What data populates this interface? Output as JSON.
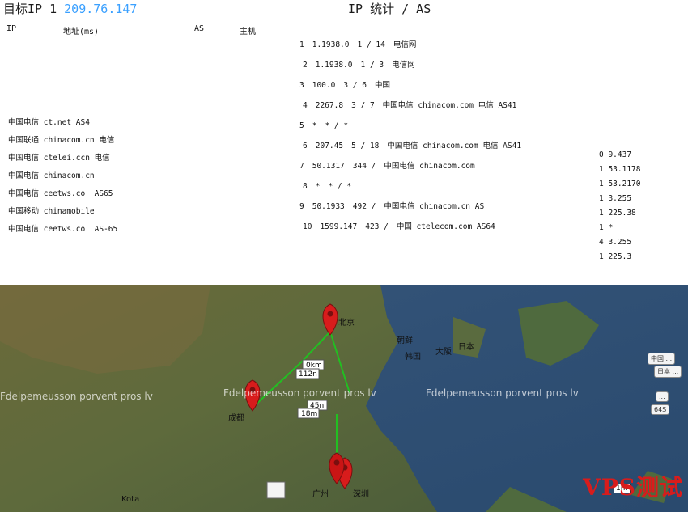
{
  "header": {
    "ip_prefix": "目标IP 1",
    "ip_highlight": "209.76.147",
    "mid_title": "IP 统计 / AS"
  },
  "columns": [
    "IP",
    "地址(ms)",
    "",
    "AS",
    "主机"
  ],
  "rows": [
    {
      "hop": "1",
      "ip": "1.1938.0",
      "loss": "1 / 14",
      "isp": "电信网"
    },
    {
      "hop": "2",
      "ip": "1.1938.0",
      "loss": "1 / 3",
      "isp": "电信网"
    },
    {
      "hop": "3",
      "ip": "100.0",
      "loss": "3 / 6",
      "isp": "中国"
    },
    {
      "hop": "4",
      "ip": "2267.8",
      "loss": "3 / 7",
      "isp": "中国电信 chinacom.com 电信 AS41"
    },
    {
      "hop": "5",
      "ip": "*",
      "loss": "* / *",
      "isp": ""
    },
    {
      "hop": "6",
      "ip": "207.45",
      "loss": "5 / 18",
      "isp": "中国电信 chinacom.com 电信 AS41"
    },
    {
      "hop": "7",
      "ip": "50.1317",
      "loss": "344 /",
      "isp": "中国电信 chinacom.com"
    },
    {
      "hop": "8",
      "ip": "*",
      "loss": "* / *",
      "isp": ""
    },
    {
      "hop": "9",
      "ip": "50.1933",
      "loss": "492 /",
      "isp": "中国电信 chinacom.cn AS"
    },
    {
      "hop": "10",
      "ip": "1599.147",
      "loss": "423 /",
      "isp": "中国 ctelecom.com AS64"
    }
  ],
  "left_rows": [
    "中国电信 ct.net AS4",
    "中国联通 chinacom.cn 电信",
    "中国电信 ctelei.ccn 电信",
    "中国电信 chinacom.cn",
    "中国电信 ceetws.co  AS65",
    "中国移动 chinamobile",
    "中国电信 ceetws.co  AS-65"
  ],
  "right_rows": [
    "0 9.437",
    "1 53.1178",
    "1 53.2170",
    "1 3.255",
    "1 225.38",
    "1 *",
    "4 3.255",
    "1 225.3"
  ],
  "map": {
    "watermark": "Fdelpemeusson porvent pros lv",
    "distances": [
      "0km",
      "112n",
      "45n",
      "18m"
    ],
    "pins": [
      {
        "label": "北京"
      },
      {
        "label": "成都"
      },
      {
        "label": "深圳"
      },
      {
        "label": "广州"
      }
    ],
    "place_labels": [
      "朝鲜",
      "韩国",
      "日本",
      "大阪",
      "Kota"
    ],
    "zoom": "1m",
    "side_bubbles": [
      "中国 ...",
      "日本 ...",
      "...",
      "64S"
    ]
  },
  "brand": "VPS测试",
  "colors": {
    "ip_highlight": "#3aa0ff",
    "pin": "#d81c1c",
    "route": "#21c021",
    "brand": "#d81c1c"
  }
}
